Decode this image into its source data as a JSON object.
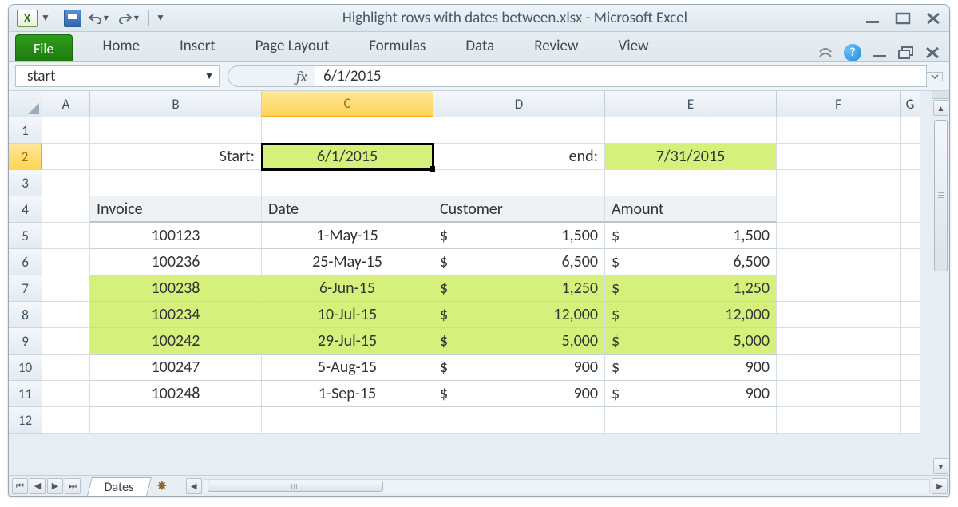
{
  "title": "Highlight rows with dates between.xlsx - Microsoft Excel",
  "tabs": {
    "file": "File",
    "home": "Home",
    "insert": "Insert",
    "pagelayout": "Page Layout",
    "formulas": "Formulas",
    "data": "Data",
    "review": "Review",
    "view": "View"
  },
  "namebox": "start",
  "fx_label": "fx",
  "formula": "6/1/2015",
  "columns": [
    "A",
    "B",
    "C",
    "D",
    "E",
    "F",
    "G"
  ],
  "rows": [
    "1",
    "2",
    "3",
    "4",
    "5",
    "6",
    "7",
    "8",
    "9",
    "10",
    "11",
    "12"
  ],
  "active_col": "C",
  "active_row": "2",
  "labels": {
    "start": "Start:",
    "end": "end:"
  },
  "start_value": "6/1/2015",
  "end_value": "7/31/2015",
  "table": {
    "headers": {
      "invoice": "Invoice",
      "date": "Date",
      "customer": "Customer",
      "amount": "Amount"
    },
    "rows": [
      {
        "hl": false,
        "invoice": "100123",
        "date": "1-May-15",
        "customer": "1,500",
        "amount": "1,500"
      },
      {
        "hl": false,
        "invoice": "100236",
        "date": "25-May-15",
        "customer": "6,500",
        "amount": "6,500"
      },
      {
        "hl": true,
        "invoice": "100238",
        "date": "6-Jun-15",
        "customer": "1,250",
        "amount": "1,250"
      },
      {
        "hl": true,
        "invoice": "100234",
        "date": "10-Jul-15",
        "customer": "12,000",
        "amount": "12,000"
      },
      {
        "hl": true,
        "invoice": "100242",
        "date": "29-Jul-15",
        "customer": "5,000",
        "amount": "5,000"
      },
      {
        "hl": false,
        "invoice": "100247",
        "date": "5-Aug-15",
        "customer": "900",
        "amount": "900"
      },
      {
        "hl": false,
        "invoice": "100248",
        "date": "1-Sep-15",
        "customer": "900",
        "amount": "900"
      }
    ]
  },
  "currency": "$",
  "sheet": "Dates"
}
